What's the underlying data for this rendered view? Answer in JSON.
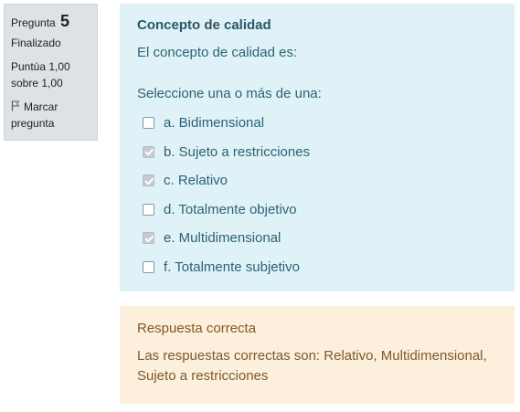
{
  "info": {
    "question_label": "Pregunta",
    "question_number": "5",
    "state": "Finalizado",
    "grade": "Puntúa 1,00 sobre 1,00",
    "flag_label": "Marcar pregunta",
    "flag_icon": "flag-icon"
  },
  "question": {
    "title": "Concepto de calidad",
    "text": "El concepto de calidad es:",
    "prompt": "Seleccione una o más de una:",
    "answers": [
      {
        "label": "a. Bidimensional",
        "checked": false
      },
      {
        "label": "b. Sujeto a restricciones",
        "checked": true
      },
      {
        "label": "c. Relativo",
        "checked": true
      },
      {
        "label": "d. Totalmente objetivo",
        "checked": false
      },
      {
        "label": "e. Multidimensional",
        "checked": true
      },
      {
        "label": "f. Totalmente subjetivo",
        "checked": false
      }
    ]
  },
  "outcome": {
    "feedback": "Respuesta correcta",
    "right_answer": "Las respuestas correctas son: Relativo, Multidimensional, Sujeto a restricciones"
  },
  "colors": {
    "info_bg": "#dee2e6",
    "question_bg": "#def2f8",
    "question_text": "#2e6274",
    "feedback_bg": "#fcefdc",
    "feedback_text": "#7d5a29"
  }
}
